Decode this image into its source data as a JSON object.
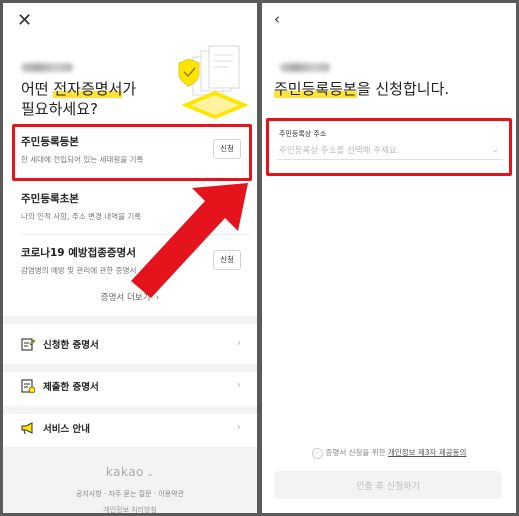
{
  "left": {
    "close_icon": "close-icon",
    "headline_plain": "어떤 ",
    "headline_highlight": "전자증명서",
    "headline_rest": "가",
    "headline_line2": "필요하세요?",
    "certificates": [
      {
        "title": "주민등록등본",
        "desc": "한 세대에 전입되어 있는 세대원을 기록",
        "button": "신청"
      },
      {
        "title": "주민등록초본",
        "desc": "나의 인적 사항, 주소 변경 내역을 기록",
        "button": "신청"
      },
      {
        "title": "코로나19 예방접종증명서",
        "desc": "감염병의 예방 및 관리에 관한 증명서",
        "button": "신청"
      }
    ],
    "more_label": "증명서 더보기",
    "menu": [
      {
        "label": "신청한 증명서",
        "icon": "edit-document-icon"
      },
      {
        "label": "제출한 증명서",
        "icon": "submitted-document-icon"
      },
      {
        "label": "서비스 안내",
        "icon": "megaphone-icon"
      }
    ],
    "footer": {
      "brand": "kakao",
      "links": "공지사항 · 자주 묻는 질문 · 이용약관",
      "bottom": "개인정보 처리방침"
    }
  },
  "right": {
    "back_icon": "back-arrow-icon",
    "headline_highlight": "주민등록등본",
    "headline_rest": "을 신청합니다.",
    "field_label": "주민등록상 주소",
    "field_placeholder": "주민등록상 주소를 선택해 주세요.",
    "consent_text": "증명서 신청을 위한 ",
    "consent_link": "개인정보 제3자 제공동의",
    "submit_label": "인증 후 신청하기"
  },
  "colors": {
    "highlight": "#ffe234",
    "annotation_red": "#e5131c",
    "accent_yellow": "#fee500"
  }
}
